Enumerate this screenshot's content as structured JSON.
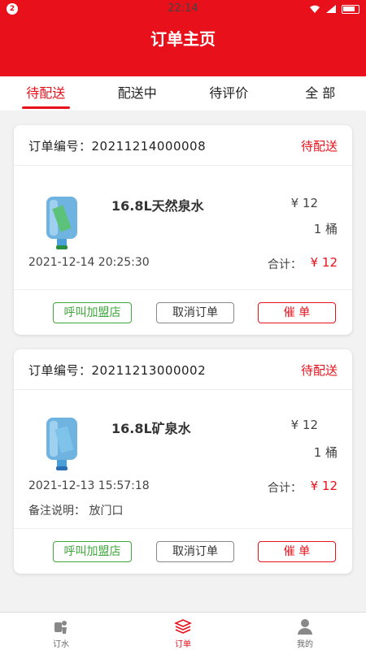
{
  "statusbar": {
    "sim": "2",
    "time": "22:14"
  },
  "header": {
    "title": "订单主页"
  },
  "tabs": [
    {
      "label": "待配送",
      "active": true
    },
    {
      "label": "配送中",
      "active": false
    },
    {
      "label": "待评价",
      "active": false
    },
    {
      "label": "全 部",
      "active": false
    }
  ],
  "orders": [
    {
      "order_label": "订单编号：",
      "order_no": "20211214000008",
      "status": "待配送",
      "product_name": "16.8L天然泉水",
      "price": "¥ 12",
      "quantity": "1 桶",
      "time": "2021-12-14 20:25:30",
      "total_label": "合计：",
      "total": "¥ 12",
      "remark": ""
    },
    {
      "order_label": "订单编号：",
      "order_no": "20211213000002",
      "status": "待配送",
      "product_name": "16.8L矿泉水",
      "price": "¥ 12",
      "quantity": "1 桶",
      "time": "2021-12-13 15:57:18",
      "total_label": "合计：",
      "total": "¥ 12",
      "remark": "备注说明：  放门口"
    }
  ],
  "buttons": {
    "call_store": "呼叫加盟店",
    "cancel_order": "取消订单",
    "urge_order": "催 单"
  },
  "bottom_nav": [
    {
      "label": "订水",
      "icon": "water-delivery-icon"
    },
    {
      "label": "订单",
      "icon": "orders-icon"
    },
    {
      "label": "我的",
      "icon": "user-icon"
    }
  ],
  "colors": {
    "accent": "#e8101b",
    "green": "#3fa83a"
  }
}
